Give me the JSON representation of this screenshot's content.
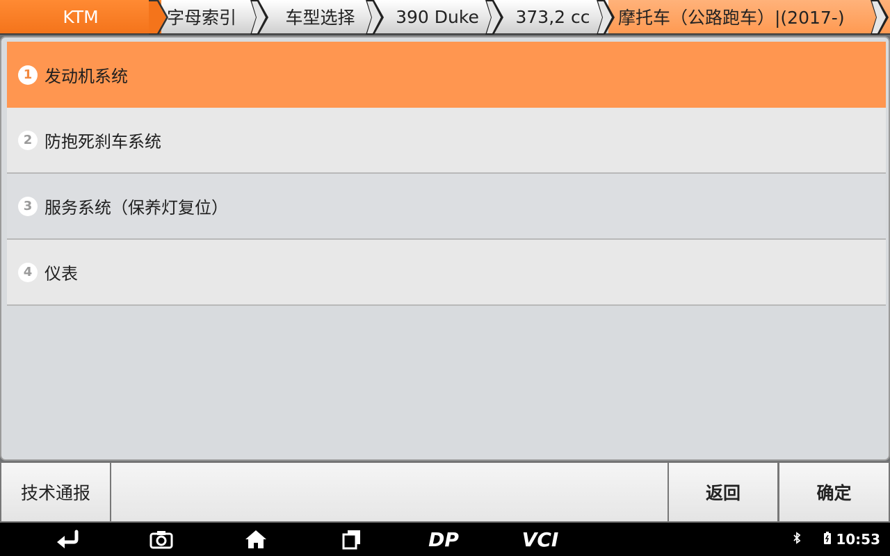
{
  "breadcrumbs": [
    {
      "label": "KTM"
    },
    {
      "label": "字母索引"
    },
    {
      "label": "车型选择"
    },
    {
      "label": "390 Duke"
    },
    {
      "label": "373,2 cc"
    },
    {
      "label": "摩托车（公路跑车）|(2017-)"
    }
  ],
  "systems": [
    {
      "num": "1",
      "label": "发动机系统"
    },
    {
      "num": "2",
      "label": "防抱死刹车系统"
    },
    {
      "num": "3",
      "label": "服务系统（保养灯复位）"
    },
    {
      "num": "4",
      "label": "仪表"
    }
  ],
  "toolbar": {
    "tech_bulletin": "技术通报",
    "back": "返回",
    "confirm": "确定"
  },
  "navbar": {
    "icons": [
      "back-icon",
      "camera-icon",
      "home-icon",
      "recent-apps-icon",
      "dp-icon",
      "vci-icon"
    ],
    "dp_label": "DP",
    "vci_label": "VCI"
  },
  "status": {
    "time": "10:53",
    "icons": [
      "bluetooth-icon",
      "wifi-icon",
      "battery-icon"
    ]
  },
  "colors": {
    "accent": "#f4741b",
    "selected_row": "#ff9650",
    "breadcrumb_last": "#ff9a52"
  }
}
